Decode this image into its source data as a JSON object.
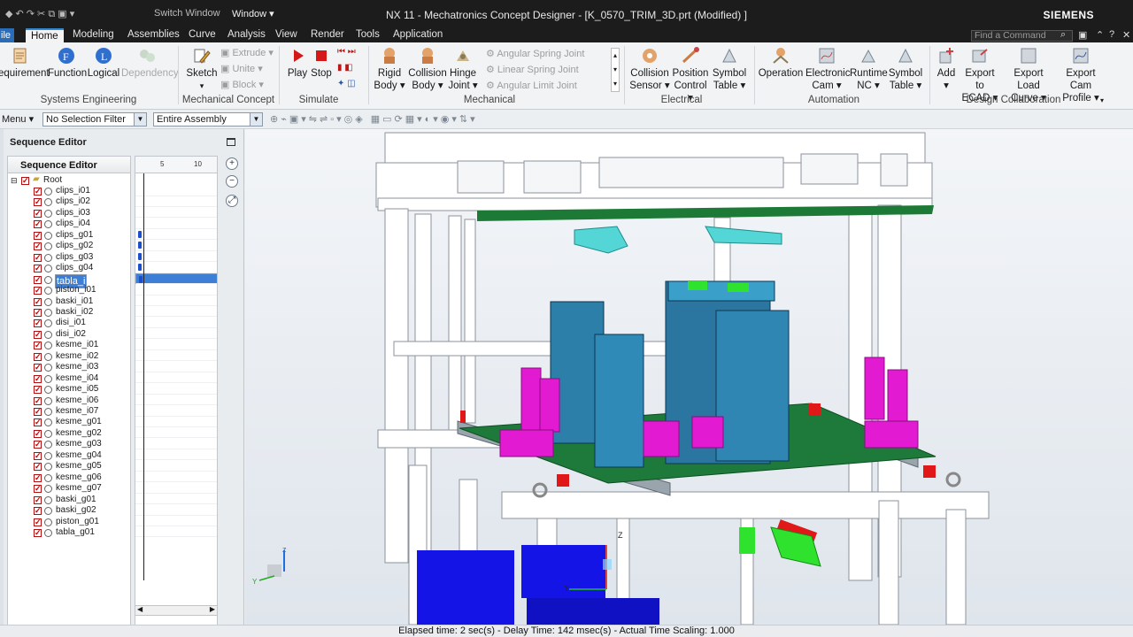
{
  "titlebar": {
    "switch_window": "Switch Window",
    "window_menu": "Window ▾",
    "title": "NX 11 - Mechatronics Concept Designer - [K_0570_TRIM_3D.prt (Modified) ]",
    "brand": "SIEMENS"
  },
  "tabs": {
    "file": "ile",
    "items": [
      "Home",
      "Modeling",
      "Assemblies",
      "Curve",
      "Analysis",
      "View",
      "Render",
      "Tools",
      "Application"
    ],
    "find_placeholder": "Find a Command"
  },
  "ribbon": {
    "systems_engineering": {
      "label": "Systems Engineering",
      "buttons": [
        "equirement",
        "Function",
        "Logical",
        "Dependency"
      ]
    },
    "mechanical_concept": {
      "label": "Mechanical Concept",
      "sketch": "Sketch",
      "small": [
        "Extrude",
        "Unite",
        "Block"
      ]
    },
    "simulate": {
      "label": "Simulate",
      "play": "Play",
      "stop": "Stop"
    },
    "mechanical": {
      "label": "Mechanical",
      "buttons": [
        [
          "Rigid",
          "Body ▾"
        ],
        [
          "Collision",
          "Body ▾"
        ],
        [
          "Hinge",
          "Joint ▾"
        ]
      ],
      "small": [
        "Angular Spring Joint",
        "Linear Spring Joint",
        "Angular Limit Joint"
      ]
    },
    "electrical": {
      "label": "Electrical",
      "buttons": [
        [
          "Collision",
          "Sensor ▾"
        ],
        [
          "Position",
          "Control ▾"
        ],
        [
          "Symbol",
          "Table ▾"
        ]
      ]
    },
    "automation": {
      "label": "Automation",
      "buttons": [
        [
          "Operation",
          ""
        ],
        [
          "Electronic",
          "Cam ▾"
        ],
        [
          "Runtime",
          "NC ▾"
        ],
        [
          "Symbol",
          "Table ▾"
        ]
      ]
    },
    "design_collaboration": {
      "label": "Design Collaboration",
      "buttons": [
        [
          "Add",
          "▾"
        ],
        [
          "Export to",
          "ECAD ▾"
        ],
        [
          "Export Load",
          "Curve ▾"
        ],
        [
          "Export Cam",
          "Profile ▾"
        ]
      ]
    }
  },
  "filterbar": {
    "menu": "Menu ▾",
    "selection_filter": "No Selection Filter",
    "scope": "Entire Assembly"
  },
  "sequence_editor": {
    "title": "Sequence Editor",
    "column_header": "Sequence Editor",
    "timeline_ticks": [
      "5",
      "10"
    ],
    "root": "Root",
    "items": [
      {
        "name": "clips_i01",
        "marker": false
      },
      {
        "name": "clips_i02",
        "marker": false
      },
      {
        "name": "clips_i03",
        "marker": false
      },
      {
        "name": "clips_i04",
        "marker": false
      },
      {
        "name": "clips_g01",
        "marker": true
      },
      {
        "name": "clips_g02",
        "marker": true
      },
      {
        "name": "clips_g03",
        "marker": true
      },
      {
        "name": "clips_g04",
        "marker": true
      },
      {
        "name": "tabla_i",
        "marker": true,
        "selected": true
      },
      {
        "name": "piston_i01",
        "marker": false
      },
      {
        "name": "baski_i01",
        "marker": false
      },
      {
        "name": "baski_i02",
        "marker": false
      },
      {
        "name": "disi_i01",
        "marker": false
      },
      {
        "name": "disi_i02",
        "marker": false
      },
      {
        "name": "kesme_i01",
        "marker": false
      },
      {
        "name": "kesme_i02",
        "marker": false
      },
      {
        "name": "kesme_i03",
        "marker": false
      },
      {
        "name": "kesme_i04",
        "marker": false
      },
      {
        "name": "kesme_i05",
        "marker": false
      },
      {
        "name": "kesme_i06",
        "marker": false
      },
      {
        "name": "kesme_i07",
        "marker": false
      },
      {
        "name": "kesme_g01",
        "marker": false
      },
      {
        "name": "kesme_g02",
        "marker": false
      },
      {
        "name": "kesme_g03",
        "marker": false
      },
      {
        "name": "kesme_g04",
        "marker": false
      },
      {
        "name": "kesme_g05",
        "marker": false
      },
      {
        "name": "kesme_g06",
        "marker": false
      },
      {
        "name": "kesme_g07",
        "marker": false
      },
      {
        "name": "baski_g01",
        "marker": false
      },
      {
        "name": "baski_g02",
        "marker": false
      },
      {
        "name": "piston_g01",
        "marker": false
      },
      {
        "name": "tabla_g01",
        "marker": false
      }
    ]
  },
  "viewport": {
    "axis_z": "z",
    "axis_y": "Y",
    "model_axis_z": "Z",
    "model_axis_y": "Y"
  },
  "status": "Elapsed time: 2 sec(s) - Delay Time: 142 msec(s) - Actual Time Scaling: 1.000"
}
